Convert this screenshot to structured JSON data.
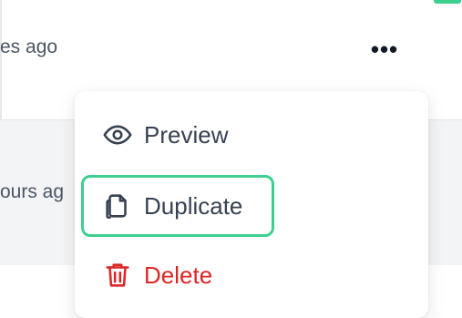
{
  "list": {
    "rows": [
      {
        "time_text": "es ago"
      },
      {
        "time_text": "ours ag"
      }
    ],
    "more_label": "•••"
  },
  "menu": {
    "items": [
      {
        "label": "Preview",
        "icon": "eye-icon"
      },
      {
        "label": "Duplicate",
        "icon": "copy-icon"
      },
      {
        "label": "Delete",
        "icon": "trash-icon",
        "color": "#dc2626"
      }
    ],
    "highlight_color": "#3ecf8e"
  }
}
